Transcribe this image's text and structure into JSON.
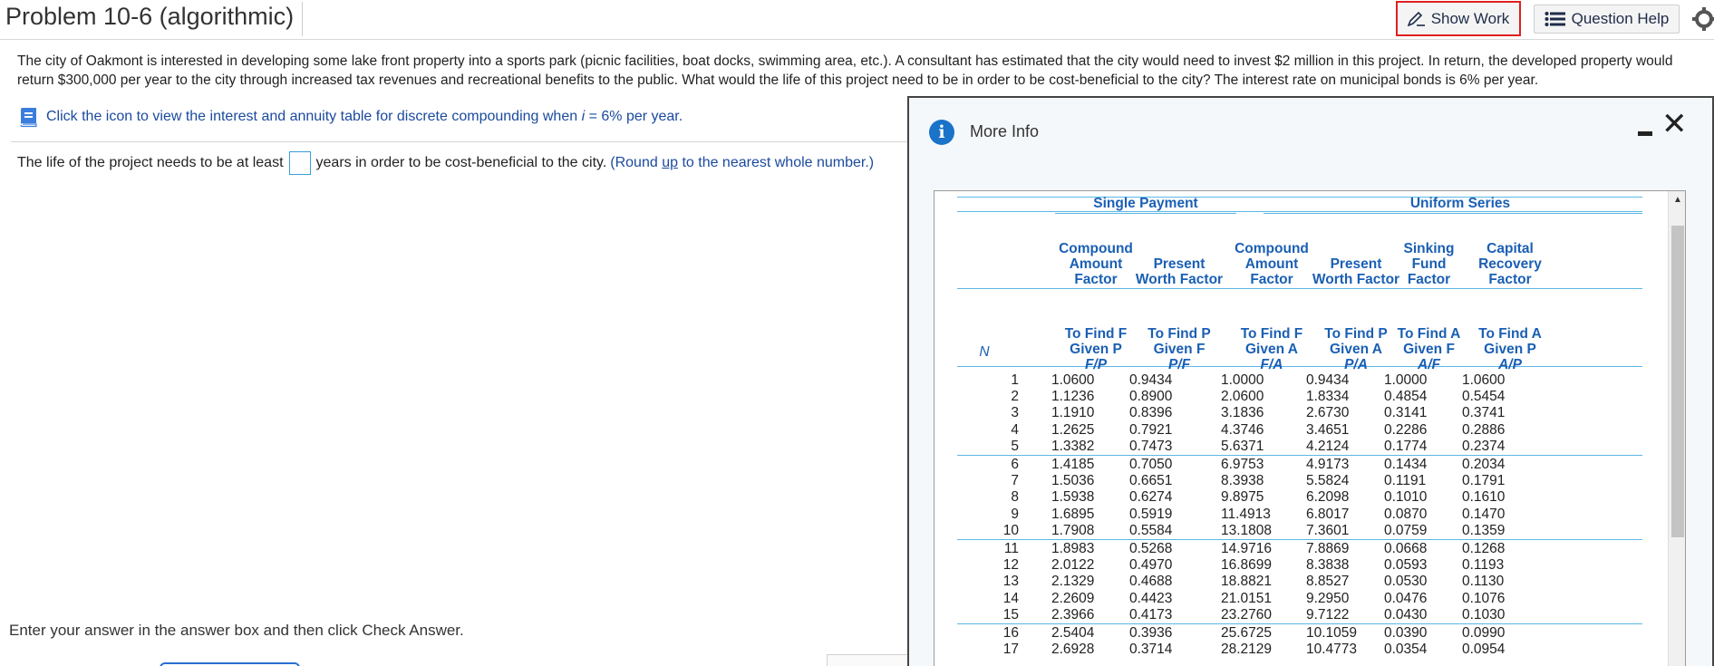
{
  "header": {
    "title": "Problem 10-6 (algorithmic)",
    "show_work": "Show Work",
    "question_help": "Question Help"
  },
  "problem": {
    "text": "The city of Oakmont is interested in developing some lake front property into a sports park (picnic facilities, boat docks, swimming area, etc.). A consultant has estimated that the city would need to invest $2 million in this project. In return, the developed property would return $300,000 per year to the city through increased tax revenues and recreational benefits to the public. What would the life of this project need to be in order to be cost-beneficial to the city? The interest rate on municipal bonds is 6% per year.",
    "icon_link": "Click the icon to view the interest and annuity table for discrete compounding when",
    "icon_link_var": "i",
    "icon_link_rate": "= 6% per year.",
    "answer_prefix": "The life of the project needs to be at least",
    "answer_suffix": "years in order to be cost-beneficial to the city.",
    "round_note_a": "(Round",
    "round_note_up": "up",
    "round_note_b": "to the nearest whole number.)",
    "answer_value": ""
  },
  "footer": {
    "instruction": "Enter your answer in the answer box and then click Check Answer."
  },
  "modal": {
    "title": "More Info",
    "group_single": "Single Payment",
    "group_uniform": "Uniform Series",
    "col_n": "N",
    "columns": [
      {
        "name_lines": [
          "Compound",
          "Amount",
          "Factor"
        ],
        "find": "To Find F",
        "given": "Given P",
        "sym": "F/P"
      },
      {
        "name_lines": [
          "",
          "Present",
          "Worth Factor"
        ],
        "find": "To Find P",
        "given": "Given F",
        "sym": "P/F"
      },
      {
        "name_lines": [
          "Compound",
          "Amount",
          "Factor"
        ],
        "find": "To Find F",
        "given": "Given A",
        "sym": "F/A"
      },
      {
        "name_lines": [
          "",
          "Present",
          "Worth Factor"
        ],
        "find": "To Find P",
        "given": "Given A",
        "sym": "P/A"
      },
      {
        "name_lines": [
          "Sinking",
          "Fund",
          "Factor"
        ],
        "find": "To Find A",
        "given": "Given F",
        "sym": "A/F"
      },
      {
        "name_lines": [
          "Capital",
          "Recovery",
          "Factor"
        ],
        "find": "To Find A",
        "given": "Given P",
        "sym": "A/P"
      }
    ],
    "rows": [
      [
        "1",
        "1.0600",
        "0.9434",
        "1.0000",
        "0.9434",
        "1.0000",
        "1.0600"
      ],
      [
        "2",
        "1.1236",
        "0.8900",
        "2.0600",
        "1.8334",
        "0.4854",
        "0.5454"
      ],
      [
        "3",
        "1.1910",
        "0.8396",
        "3.1836",
        "2.6730",
        "0.3141",
        "0.3741"
      ],
      [
        "4",
        "1.2625",
        "0.7921",
        "4.3746",
        "3.4651",
        "0.2286",
        "0.2886"
      ],
      [
        "5",
        "1.3382",
        "0.7473",
        "5.6371",
        "4.2124",
        "0.1774",
        "0.2374"
      ],
      [
        "6",
        "1.4185",
        "0.7050",
        "6.9753",
        "4.9173",
        "0.1434",
        "0.2034"
      ],
      [
        "7",
        "1.5036",
        "0.6651",
        "8.3938",
        "5.5824",
        "0.1191",
        "0.1791"
      ],
      [
        "8",
        "1.5938",
        "0.6274",
        "9.8975",
        "6.2098",
        "0.1010",
        "0.1610"
      ],
      [
        "9",
        "1.6895",
        "0.5919",
        "11.4913",
        "6.8017",
        "0.0870",
        "0.1470"
      ],
      [
        "10",
        "1.7908",
        "0.5584",
        "13.1808",
        "7.3601",
        "0.0759",
        "0.1359"
      ],
      [
        "11",
        "1.8983",
        "0.5268",
        "14.9716",
        "7.8869",
        "0.0668",
        "0.1268"
      ],
      [
        "12",
        "2.0122",
        "0.4970",
        "16.8699",
        "8.3838",
        "0.0593",
        "0.1193"
      ],
      [
        "13",
        "2.1329",
        "0.4688",
        "18.8821",
        "8.8527",
        "0.0530",
        "0.1130"
      ],
      [
        "14",
        "2.2609",
        "0.4423",
        "21.0151",
        "9.2950",
        "0.0476",
        "0.1076"
      ],
      [
        "15",
        "2.3966",
        "0.4173",
        "23.2760",
        "9.7122",
        "0.0430",
        "0.1030"
      ],
      [
        "16",
        "2.5404",
        "0.3936",
        "25.6725",
        "10.1059",
        "0.0390",
        "0.0990"
      ],
      [
        "17",
        "2.6928",
        "0.3714",
        "28.2129",
        "10.4773",
        "0.0354",
        "0.0954"
      ]
    ]
  },
  "colors": {
    "accent_blue": "#1a5fb4",
    "table_rule": "#5cb8e6",
    "show_work_border": "#e02020",
    "info_icon": "#1a73c8"
  }
}
